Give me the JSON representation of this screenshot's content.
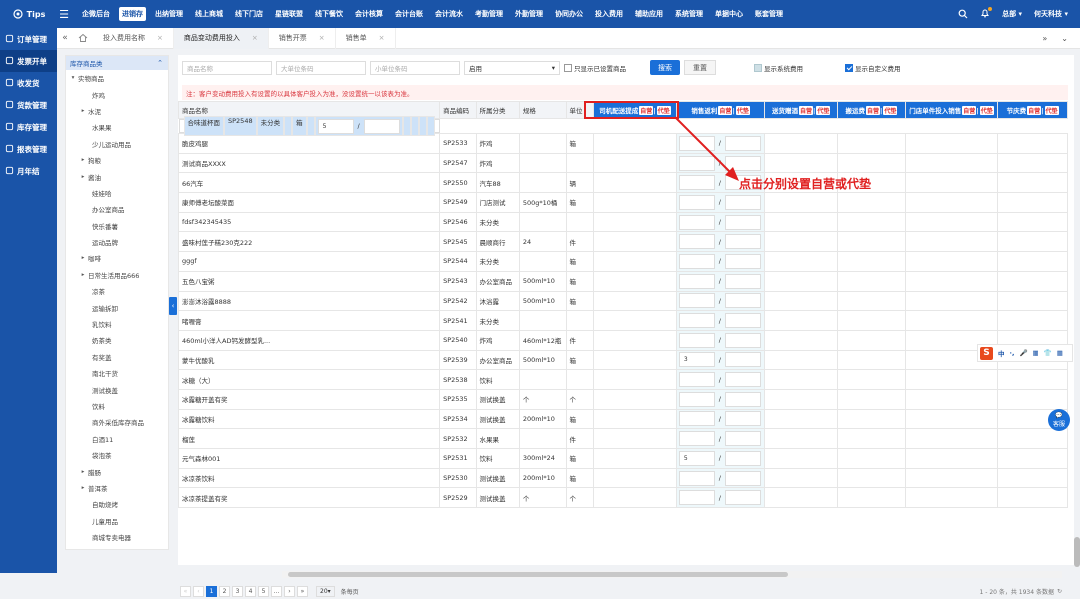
{
  "topbar": {
    "tips": "Tips",
    "nav": [
      "企微后台",
      "进销存",
      "出纳管理",
      "线上商城",
      "线下门店",
      "星链联盟",
      "线下餐饮",
      "会计核算",
      "会计台账",
      "会计流水",
      "考勤管理",
      "外勤管理",
      "协同办公",
      "投入费用",
      "辅助应用",
      "系统管理",
      "单据中心",
      "账套管理"
    ],
    "active_nav": 1,
    "user": "总部",
    "company": "何天科技"
  },
  "sidebar": [
    "订单管理",
    "发票开单",
    "收发货",
    "货款管理",
    "库存管理",
    "报表管理",
    "月年结"
  ],
  "sidebar_active": 1,
  "tabs": [
    {
      "label": "投入费用名称",
      "active": false
    },
    {
      "label": "商品变动费用投入",
      "active": true
    },
    {
      "label": "销售开票",
      "active": false
    },
    {
      "label": "销售单",
      "active": false
    }
  ],
  "tree": {
    "title": "库存商品类",
    "nodes": [
      {
        "label": "实物商品",
        "level": 0,
        "arrow": "▾"
      },
      {
        "label": "炸鸡",
        "level": 1,
        "arrow": ""
      },
      {
        "label": "水泥",
        "level": 1,
        "arrow": "▸"
      },
      {
        "label": "水果果",
        "level": 1,
        "arrow": ""
      },
      {
        "label": "少儿运动用品",
        "level": 1,
        "arrow": ""
      },
      {
        "label": "狗粮",
        "level": 1,
        "arrow": "▸"
      },
      {
        "label": "酱油",
        "level": 1,
        "arrow": "▸"
      },
      {
        "label": "娃娃哈",
        "level": 1,
        "arrow": ""
      },
      {
        "label": "办公室商品",
        "level": 1,
        "arrow": ""
      },
      {
        "label": "快乐番薯",
        "level": 1,
        "arrow": ""
      },
      {
        "label": "运动品牌",
        "level": 1,
        "arrow": ""
      },
      {
        "label": "咖啡",
        "level": 1,
        "arrow": "▸"
      },
      {
        "label": "日常生活用品666",
        "level": 1,
        "arrow": "▸"
      },
      {
        "label": "凉茶",
        "level": 1,
        "arrow": ""
      },
      {
        "label": "运输拆卸",
        "level": 1,
        "arrow": ""
      },
      {
        "label": "乳饮料",
        "level": 1,
        "arrow": ""
      },
      {
        "label": "奶茶类",
        "level": 1,
        "arrow": ""
      },
      {
        "label": "有奖盖",
        "level": 1,
        "arrow": ""
      },
      {
        "label": "南北干货",
        "level": 1,
        "arrow": ""
      },
      {
        "label": "测试换盖",
        "level": 1,
        "arrow": ""
      },
      {
        "label": "饮料",
        "level": 1,
        "arrow": ""
      },
      {
        "label": "商外采低库存商品",
        "level": 1,
        "arrow": ""
      },
      {
        "label": "白酒11",
        "level": 1,
        "arrow": ""
      },
      {
        "label": "袋泡茶",
        "level": 1,
        "arrow": ""
      },
      {
        "label": "腊肠",
        "level": 1,
        "arrow": "▸"
      },
      {
        "label": "普洱茶",
        "level": 1,
        "arrow": "▸"
      },
      {
        "label": "自助烧烤",
        "level": 1,
        "arrow": ""
      },
      {
        "label": "儿童用品",
        "level": 1,
        "arrow": ""
      },
      {
        "label": "商城专卖电器",
        "level": 1,
        "arrow": ""
      }
    ]
  },
  "filters": {
    "name_ph": "商品名称",
    "big_code_ph": "大单位条码",
    "small_code_ph": "小单位条码",
    "status": "启用",
    "only_set": "只显示已设置商品",
    "search": "搜索",
    "reset": "重置",
    "show_system": "显示系统费用",
    "show_custom": "显示自定义费用"
  },
  "notice": "注：客户变动费用投入有设置的以具体客户投入为准，没设置统一以该表为准。",
  "table": {
    "headers": [
      "商品名称",
      "商品编码",
      "所属分类",
      "规格",
      "单位"
    ],
    "cost_headers": [
      "司机配送提成",
      "销售返利",
      "送货赠酒",
      "搬运费",
      "门店单件投入销售",
      "节庆费"
    ],
    "tag_self": "自营",
    "tag_adv": "代垫",
    "rows": [
      {
        "name": "合味道杯面",
        "code": "SP2548",
        "cat": "未分类",
        "spec": "",
        "unit": "箱",
        "v1": "5"
      },
      {
        "name": "脆皮鸡腿",
        "code": "SP2533",
        "cat": "炸鸡",
        "spec": "",
        "unit": "箱",
        "v1": ""
      },
      {
        "name": "测试商品XXXX",
        "code": "SP2547",
        "cat": "炸鸡",
        "spec": "",
        "unit": "",
        "v1": ""
      },
      {
        "name": "66汽车",
        "code": "SP2550",
        "cat": "汽车88",
        "spec": "",
        "unit": "辆",
        "v1": ""
      },
      {
        "name": "康师傅老坛酸菜面",
        "code": "SP2549",
        "cat": "门店测试",
        "spec": "500g*10桶",
        "unit": "箱",
        "v1": ""
      },
      {
        "name": "fdsf342345435",
        "code": "SP2546",
        "cat": "未分类",
        "spec": "",
        "unit": "",
        "v1": ""
      },
      {
        "name": "盛味村莲子糕230克222",
        "code": "SP2545",
        "cat": "晨顺商行",
        "spec": "24",
        "unit": "件",
        "v1": ""
      },
      {
        "name": "gggf",
        "code": "SP2544",
        "cat": "未分类",
        "spec": "",
        "unit": "箱",
        "v1": ""
      },
      {
        "name": "五色八宝粥",
        "code": "SP2543",
        "cat": "办公室商品",
        "spec": "500ml*10",
        "unit": "箱",
        "v1": ""
      },
      {
        "name": "澎澎沐浴露8888",
        "code": "SP2542",
        "cat": "沐浴露",
        "spec": "500ml*10",
        "unit": "箱",
        "v1": ""
      },
      {
        "name": "啫喱膏",
        "code": "SP2541",
        "cat": "未分类",
        "spec": "",
        "unit": "",
        "v1": ""
      },
      {
        "name": "460ml小洋人AD钙发酵型乳...",
        "code": "SP2540",
        "cat": "炸鸡",
        "spec": "460ml*12瓶",
        "unit": "件",
        "v1": ""
      },
      {
        "name": "蒙牛优酸乳",
        "code": "SP2539",
        "cat": "办公室商品",
        "spec": "500ml*10",
        "unit": "箱",
        "v1": "3"
      },
      {
        "name": "冰糖（大）",
        "code": "SP2538",
        "cat": "饮料",
        "spec": "",
        "unit": "",
        "v1": ""
      },
      {
        "name": "冰露糖开盖有奖",
        "code": "SP2535",
        "cat": "测试换盖",
        "spec": "个",
        "unit": "个",
        "v1": ""
      },
      {
        "name": "冰露糖饮料",
        "code": "SP2534",
        "cat": "测试换盖",
        "spec": "200ml*10",
        "unit": "箱",
        "v1": ""
      },
      {
        "name": "榴莲",
        "code": "SP2532",
        "cat": "水果果",
        "spec": "",
        "unit": "件",
        "v1": ""
      },
      {
        "name": "元气森林001",
        "code": "SP2531",
        "cat": "饮料",
        "spec": "300ml*24",
        "unit": "箱",
        "v1": "5"
      },
      {
        "name": "冰凉茶饮料",
        "code": "SP2530",
        "cat": "测试换盖",
        "spec": "200ml*10",
        "unit": "箱",
        "v1": ""
      },
      {
        "name": "冰凉茶提盖有奖",
        "code": "SP2529",
        "cat": "测试换盖",
        "spec": "个",
        "unit": "个",
        "v1": ""
      }
    ]
  },
  "annotation": "点击分别设置自营或代垫",
  "pager": {
    "pages": [
      "1",
      "2",
      "3",
      "4",
      "5",
      "..."
    ],
    "size": "20",
    "size_unit": "条每页",
    "info": "1 - 20 条，共 1934 条数据"
  },
  "ime": [
    "中",
    "·,",
    "🎤",
    "▦",
    "👕",
    "▦"
  ],
  "service": "客服"
}
